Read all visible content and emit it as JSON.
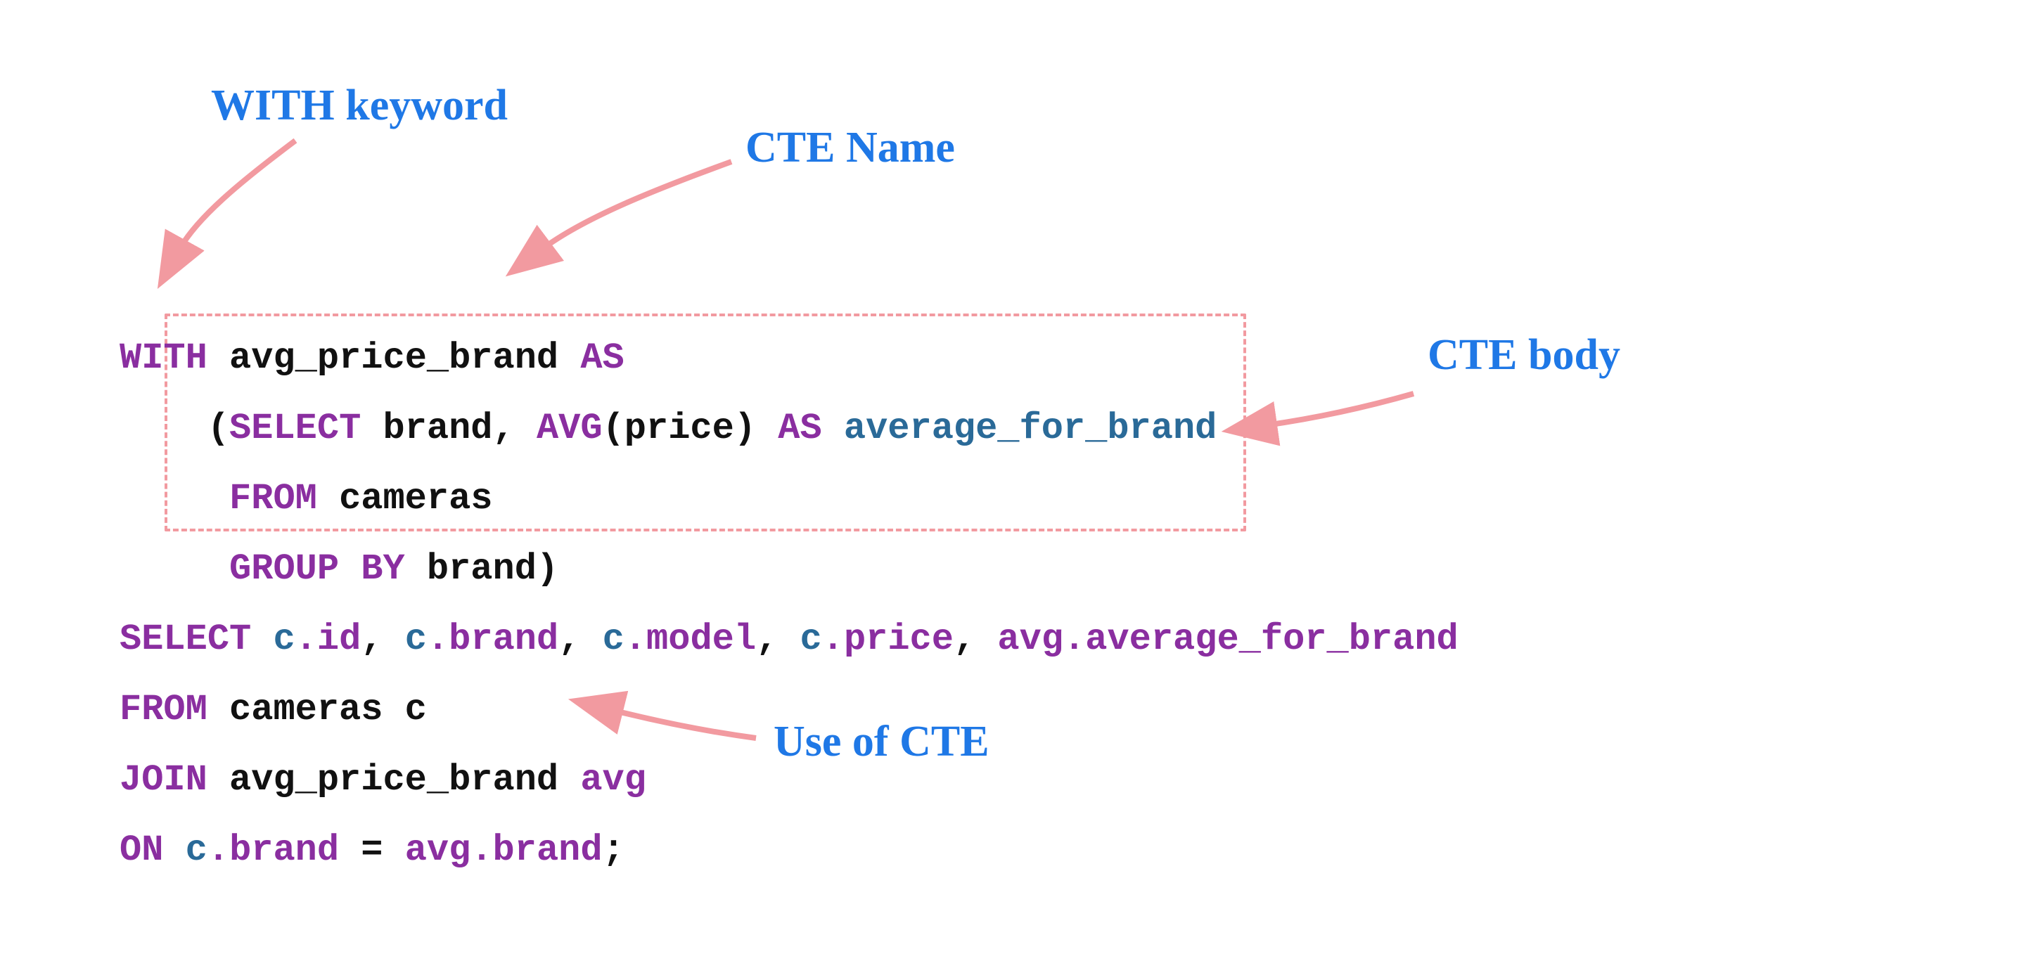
{
  "annotations": {
    "with_keyword": "WITH keyword",
    "cte_name": "CTE Name",
    "cte_body": "CTE body",
    "use_of_cte": "Use of CTE"
  },
  "code": {
    "l1": {
      "with": "WITH",
      "name": "avg_price_brand",
      "as": "AS"
    },
    "l2": {
      "open": "(",
      "select": "SELECT",
      "brand": " brand",
      "comma": ",",
      "avg": "AVG",
      "priceexpr": "(price)",
      "as": "AS",
      "alias": "average_for_brand"
    },
    "l3": {
      "from": "FROM",
      "table": " cameras"
    },
    "l4": {
      "groupby": "GROUP BY",
      "col": " brand",
      "close": ")"
    },
    "l5": {
      "select": "SELECT",
      "c1a": "c",
      "c1b": ".id",
      "c2a": "c",
      "c2b": ".brand",
      "c3a": "c",
      "c3b": ".model",
      "c4a": "c",
      "c4b": ".price",
      "c5a": "avg",
      "c5b": ".average_for_brand",
      "comma": ","
    },
    "l6": {
      "from": "FROM",
      "rest": " cameras c"
    },
    "l7": {
      "join": "JOIN",
      "rest": " avg_price_brand ",
      "alias": "avg"
    },
    "l8": {
      "on": "ON",
      "l1a": "c",
      "l1b": ".brand",
      "eq": " = ",
      "r1a": "avg",
      "r1b": ".brand",
      "semi": ";"
    }
  },
  "colors": {
    "arrow": "#f29aa0",
    "annotation": "#1f78e6",
    "keyword": "#8a2ea0",
    "identifier": "#2a6a98"
  }
}
